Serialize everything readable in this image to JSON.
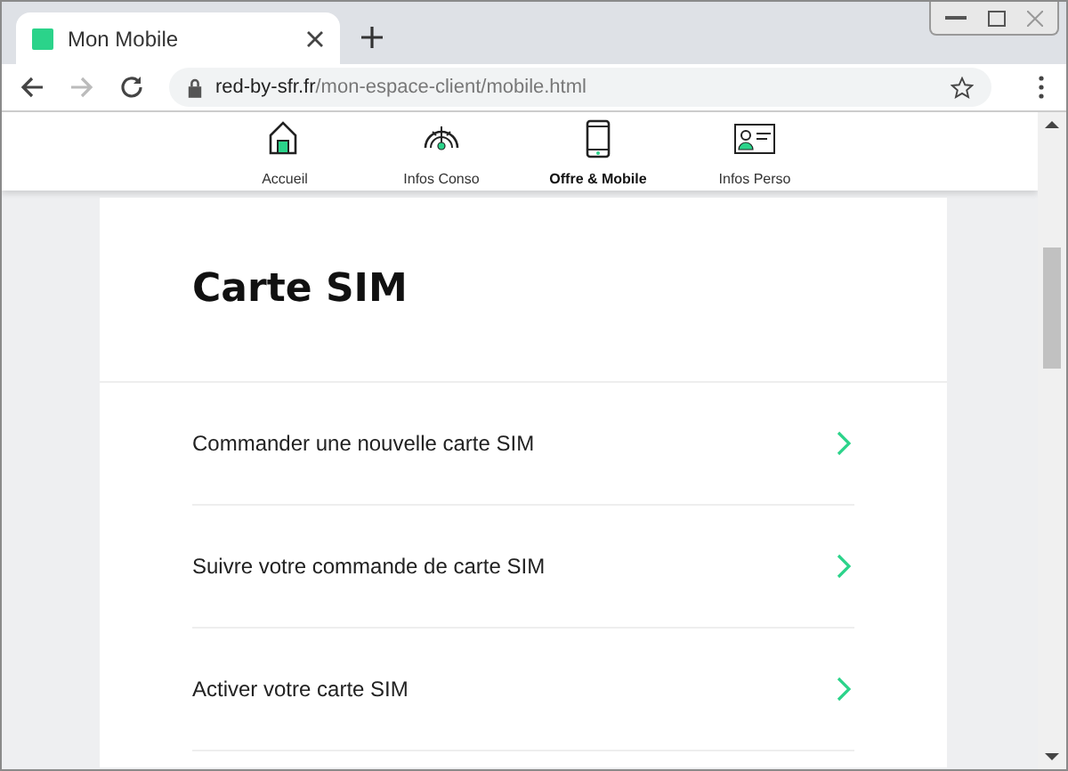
{
  "browser": {
    "tab_title": "Mon Mobile",
    "url_host": "red-by-sfr.fr",
    "url_path": "/mon-espace-client/mobile.html"
  },
  "nav": [
    {
      "label": "Accueil",
      "selected": false
    },
    {
      "label": "Infos Conso",
      "selected": false
    },
    {
      "label": "Offre & Mobile",
      "selected": true
    },
    {
      "label": "Infos Perso",
      "selected": false
    }
  ],
  "card": {
    "title": "Carte SIM",
    "links": [
      "Commander une nouvelle carte SIM",
      "Suivre votre commande de carte SIM",
      "Activer votre carte SIM"
    ]
  }
}
